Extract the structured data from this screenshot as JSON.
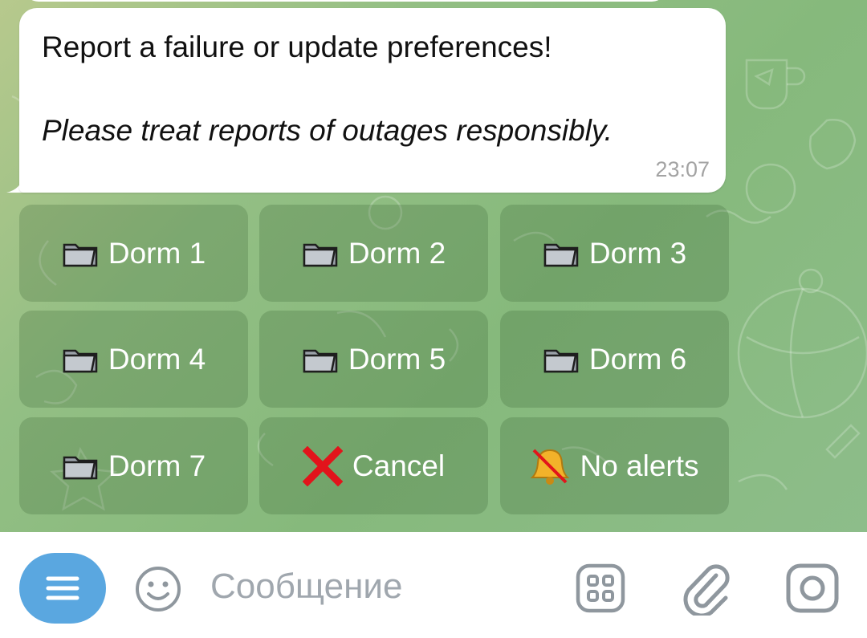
{
  "message": {
    "line1": "Report a failure or update preferences!",
    "line2": "Please treat reports of outages responsibly.",
    "time": "23:07"
  },
  "keyboard": {
    "buttons": [
      {
        "label": "Dorm 1",
        "icon": "folder-icon"
      },
      {
        "label": "Dorm 2",
        "icon": "folder-icon"
      },
      {
        "label": "Dorm 3",
        "icon": "folder-icon"
      },
      {
        "label": "Dorm 4",
        "icon": "folder-icon"
      },
      {
        "label": "Dorm 5",
        "icon": "folder-icon"
      },
      {
        "label": "Dorm 6",
        "icon": "folder-icon"
      },
      {
        "label": "Dorm 7",
        "icon": "folder-icon"
      },
      {
        "label": "Cancel",
        "icon": "cross-mark-icon"
      },
      {
        "label": "No alerts",
        "icon": "bell-slash-icon"
      }
    ]
  },
  "input": {
    "placeholder": "Сообщение",
    "value": ""
  },
  "icons": {
    "menu": "menu-icon",
    "emoji": "smiley-icon",
    "sticker": "sticker-grid-icon",
    "attach": "paperclip-icon",
    "camera": "camera-icon"
  },
  "colors": {
    "menu_button": "#5aa7e0",
    "chat_background": "#8dbd82",
    "icon_gray": "#8f979e",
    "cross_red": "#e2141b",
    "bell_gold": "#f2b22a"
  }
}
